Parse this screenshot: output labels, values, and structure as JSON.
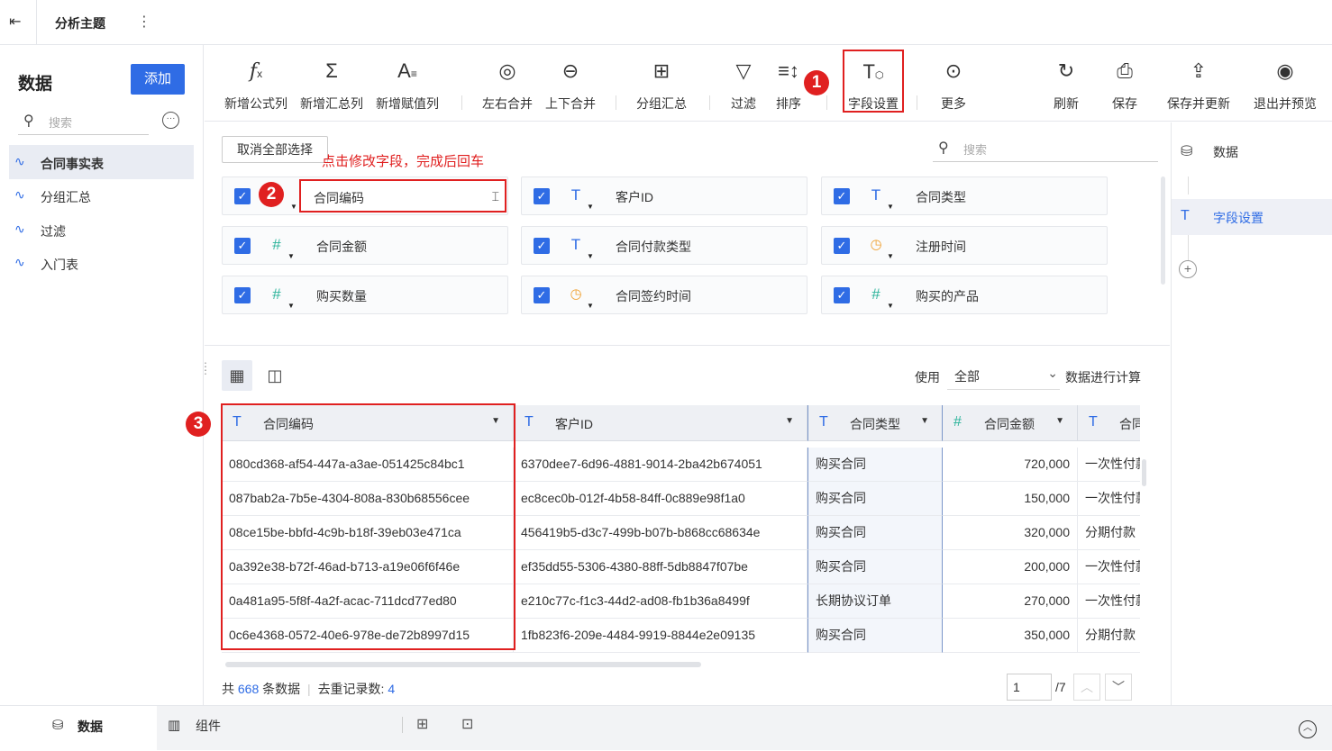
{
  "topbar": {
    "title": "分析主题"
  },
  "left": {
    "title": "数据",
    "add_label": "添加",
    "search_placeholder": "搜索",
    "items": [
      {
        "label": "合同事实表",
        "active": true
      },
      {
        "label": "分组汇总"
      },
      {
        "label": "过滤"
      },
      {
        "label": "入门表"
      }
    ]
  },
  "toolbar": {
    "new_formula": "新增公式列",
    "new_summary": "新增汇总列",
    "new_assign": "新增赋值列",
    "lr_merge": "左右合并",
    "ud_merge": "上下合并",
    "group_summary": "分组汇总",
    "filter": "过滤",
    "sort": "排序",
    "field_settings": "字段设置",
    "more": "更多",
    "refresh": "刷新",
    "save": "保存",
    "save_update": "保存并更新",
    "exit_preview": "退出并预览"
  },
  "badges": [
    "1",
    "2",
    "3"
  ],
  "fields": {
    "deselect_all": "取消全部选择",
    "hint": "点击修改字段，完成后回车",
    "search_placeholder": "搜索",
    "list": [
      {
        "name": "合同编码",
        "type": "text"
      },
      {
        "name": "客户ID",
        "type": "text"
      },
      {
        "name": "合同类型",
        "type": "text"
      },
      {
        "name": "合同金额",
        "type": "number"
      },
      {
        "name": "合同付款类型",
        "type": "text"
      },
      {
        "name": "注册时间",
        "type": "time"
      },
      {
        "name": "购买数量",
        "type": "number"
      },
      {
        "name": "合同签约时间",
        "type": "time"
      },
      {
        "name": "购买的产品",
        "type": "number"
      }
    ]
  },
  "table": {
    "use_label": "使用",
    "use_value": "全部",
    "use_after": "数据进行计算",
    "headers": [
      "合同编码",
      "客户ID",
      "合同类型",
      "合同金额",
      "合同"
    ],
    "rows": [
      [
        "080cd368-af54-447a-a3ae-051425c84bc1",
        "6370dee7-6d96-4881-9014-2ba42b674051",
        "购买合同",
        "720,000",
        "一次性付款"
      ],
      [
        "087bab2a-7b5e-4304-808a-830b68556cee",
        "ec8cec0b-012f-4b58-84ff-0c889e98f1a0",
        "购买合同",
        "150,000",
        "一次性付款"
      ],
      [
        "08ce15be-bbfd-4c9b-b18f-39eb03e471ca",
        "456419b5-d3c7-499b-b07b-b868cc68634e",
        "购买合同",
        "320,000",
        "分期付款"
      ],
      [
        "0a392e38-b72f-46ad-b713-a19e06f6f46e",
        "ef35dd55-5306-4380-88ff-5db8847f07be",
        "购买合同",
        "200,000",
        "一次性付款"
      ],
      [
        "0a481a95-5f8f-4a2f-acac-711dcd77ed80",
        "e210c77c-f1c3-44d2-ad08-fb1b36a8499f",
        "长期协议订单",
        "270,000",
        "一次性付款"
      ],
      [
        "0c6e4368-0572-40e6-978e-de72b8997d15",
        "1fb823f6-209e-4484-9919-8844e2e09135",
        "购买合同",
        "350,000",
        "分期付款"
      ]
    ],
    "footer_prefix": "共",
    "total_count": "668",
    "footer_mid": "条数据",
    "dedup_label": "去重记录数:",
    "dedup_count": "4",
    "page_current": "1",
    "page_total": "/7"
  },
  "right": {
    "data_label": "数据",
    "field_settings_label": "字段设置"
  },
  "bottom": {
    "data_tab": "数据",
    "component_tab": "组件"
  },
  "colors": {
    "accent": "#2f6ce5",
    "red": "#e02020"
  }
}
